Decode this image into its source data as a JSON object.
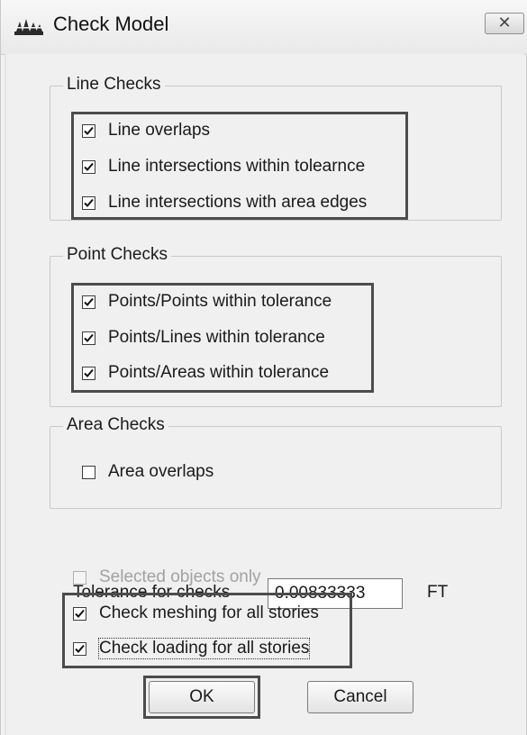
{
  "window": {
    "title": "Check Model",
    "close_glyph": "✕"
  },
  "icons": {
    "app": "app-logo-icon",
    "close": "close-icon",
    "check": "checkmark-icon"
  },
  "line_checks": {
    "label": "Line Checks",
    "items": [
      {
        "label": "Line overlaps",
        "checked": true
      },
      {
        "label": "Line intersections within tolearnce",
        "checked": true
      },
      {
        "label": "Line intersections with area edges",
        "checked": true
      }
    ]
  },
  "point_checks": {
    "label": "Point Checks",
    "items": [
      {
        "label": "Points/Points within tolerance",
        "checked": true
      },
      {
        "label": "Points/Lines within tolerance",
        "checked": true
      },
      {
        "label": "Points/Areas within tolerance",
        "checked": true
      }
    ]
  },
  "area_checks": {
    "label": "Area Checks",
    "items": [
      {
        "label": "Area overlaps",
        "checked": false
      }
    ]
  },
  "tolerance": {
    "label": "Tolerance for checks",
    "value": "0.00833333",
    "unit": "FT"
  },
  "options": {
    "selected_only": {
      "label": "Selected objects only",
      "checked": false,
      "disabled": true
    },
    "meshing": {
      "label": "Check meshing for all stories",
      "checked": true
    },
    "loading": {
      "label": "Check loading for all stories",
      "checked": true
    }
  },
  "buttons": {
    "ok": "OK",
    "cancel": "Cancel"
  }
}
